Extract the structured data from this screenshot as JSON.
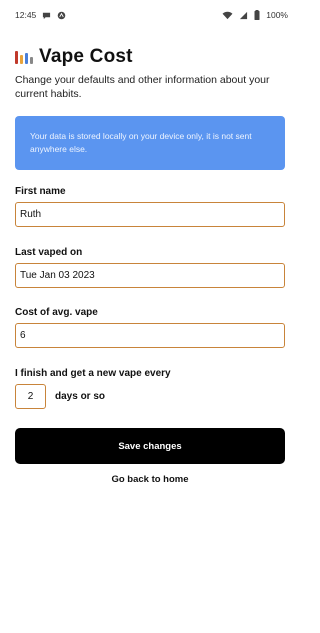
{
  "status_bar": {
    "time": "12:45",
    "battery": "100%"
  },
  "app": {
    "title": "Vape Cost",
    "logo_colors": [
      "#c0392b",
      "#e8a33a",
      "#4a7fd9",
      "#888888"
    ]
  },
  "subtitle": "Change your defaults and other information about your current habits.",
  "info_box": {
    "text": "Your data is stored locally on your device only, it is not sent anywhere else."
  },
  "form": {
    "first_name": {
      "label": "First name",
      "value": "Ruth"
    },
    "last_vaped": {
      "label": "Last vaped on",
      "value": "Tue Jan 03 2023"
    },
    "cost": {
      "label": "Cost of avg. vape",
      "value": "6"
    },
    "frequency": {
      "label": "I finish and get a new vape every",
      "value": "2",
      "suffix": "days or so"
    }
  },
  "actions": {
    "save_label": "Save changes",
    "back_label": "Go back to home"
  }
}
